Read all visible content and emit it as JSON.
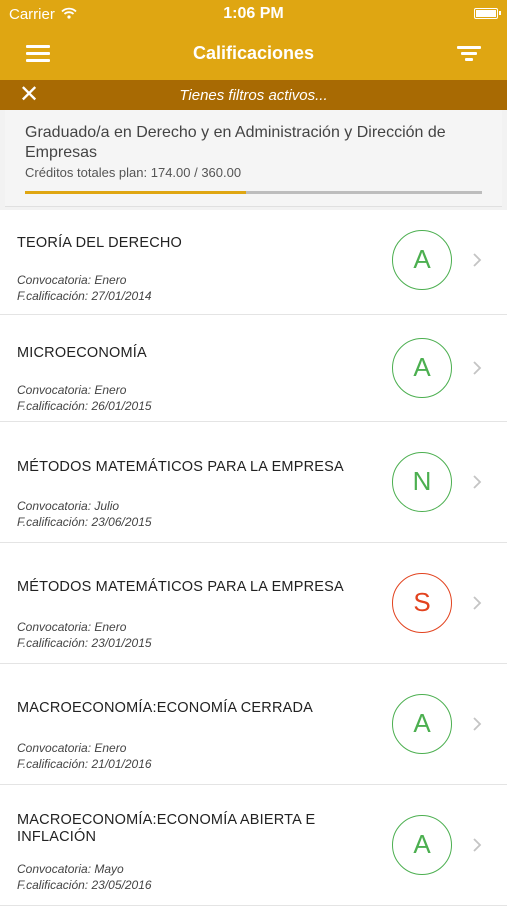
{
  "status_bar": {
    "carrier": "Carrier",
    "time": "1:06 PM"
  },
  "nav": {
    "title": "Calificaciones",
    "menu_icon": "hamburger-menu-icon",
    "filter_icon": "filter-icon"
  },
  "filter_bar": {
    "text": "Tienes filtros activos...",
    "close_icon": "close-icon"
  },
  "plan": {
    "title": "Graduado/a en Derecho y en Administración y Dirección de Empresas",
    "credits": "Créditos totales plan: 174.00 / 360.00",
    "progress_fraction": 0.483
  },
  "colors": {
    "header": "#dfa612",
    "filter_bar": "#a86a03",
    "grade_pass": "#4caf50",
    "grade_fail": "#e2431f"
  },
  "subjects": [
    {
      "title": "TEORÍA DEL DERECHO",
      "convocatoria": "Convocatoria: Enero",
      "fecha": "F.calificación: 27/01/2014",
      "grade": "A",
      "status": "pass"
    },
    {
      "title": "MICROECONOMÍA",
      "convocatoria": "Convocatoria: Enero",
      "fecha": "F.calificación: 26/01/2015",
      "grade": "A",
      "status": "pass"
    },
    {
      "title": "MÉTODOS MATEMÁTICOS PARA LA EMPRESA",
      "convocatoria": "Convocatoria: Julio",
      "fecha": "F.calificación: 23/06/2015",
      "grade": "N",
      "status": "pass"
    },
    {
      "title": "MÉTODOS MATEMÁTICOS PARA LA EMPRESA",
      "convocatoria": "Convocatoria: Enero",
      "fecha": "F.calificación: 23/01/2015",
      "grade": "S",
      "status": "fail"
    },
    {
      "title": "MACROECONOMÍA:ECONOMÍA CERRADA",
      "convocatoria": "Convocatoria: Enero",
      "fecha": "F.calificación: 21/01/2016",
      "grade": "A",
      "status": "pass"
    },
    {
      "title": "MACROECONOMÍA:ECONOMÍA ABIERTA E INFLACIÓN",
      "convocatoria": "Convocatoria: Mayo",
      "fecha": "F.calificación: 23/05/2016",
      "grade": "A",
      "status": "pass"
    }
  ]
}
